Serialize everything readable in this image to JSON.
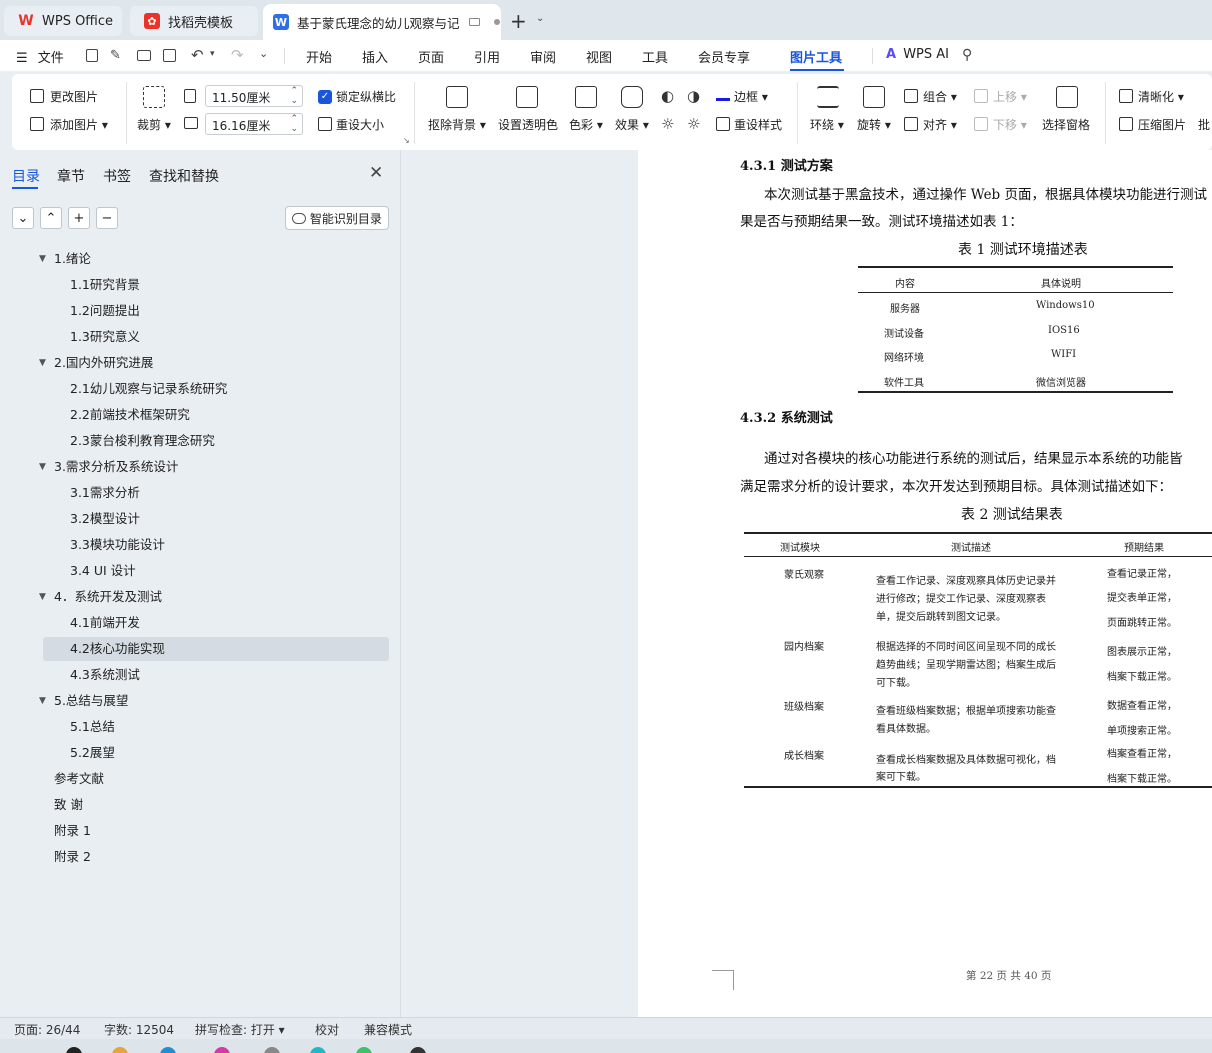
{
  "tabs": [
    {
      "label": "WPS Office",
      "icon": "wps-logo-icon",
      "color": "#e8342a"
    },
    {
      "label": "找稻壳模板",
      "icon": "docer-icon",
      "color": "#e8342a"
    },
    {
      "label": "基于蒙氏理念的幼儿观察与记",
      "icon": "word-doc-icon",
      "color": "#2f6ee6"
    }
  ],
  "menubar": {
    "file": "文件",
    "items": [
      "开始",
      "插入",
      "页面",
      "引用",
      "审阅",
      "视图",
      "工具",
      "会员专享",
      "图片工具"
    ],
    "active": "图片工具",
    "wps_ai": "WPS AI"
  },
  "ribbon": {
    "change_image": "更改图片",
    "add_image": "添加图片",
    "crop": "裁剪",
    "width": "11.50厘米",
    "height": "16.16厘米",
    "lock_ratio": "锁定纵横比",
    "lock_checked": true,
    "reset_size": "重设大小",
    "remove_bg": "抠除背景",
    "set_transparent": "设置透明色",
    "color": "色彩",
    "effect": "效果",
    "border": "边框",
    "reset_style": "重设样式",
    "wrap": "环绕",
    "rotate": "旋转",
    "group": "组合",
    "align": "对齐",
    "move_up": "上移",
    "move_down": "下移",
    "selection_pane": "选择窗格",
    "sharpen": "清晰化",
    "compress": "压缩图片",
    "batch": "批"
  },
  "panel": {
    "tabs": [
      "目录",
      "章节",
      "书签",
      "查找和替换"
    ],
    "smart_toc": "智能识别目录",
    "toc": [
      {
        "label": "1.绪论",
        "level": 1,
        "expanded": true
      },
      {
        "label": "1.1研究背景",
        "level": 2
      },
      {
        "label": "1.2问题提出",
        "level": 2
      },
      {
        "label": "1.3研究意义",
        "level": 2
      },
      {
        "label": "2.国内外研究进展",
        "level": 1,
        "expanded": true
      },
      {
        "label": "2.1幼儿观察与记录系统研究",
        "level": 2
      },
      {
        "label": "2.2前端技术框架研究",
        "level": 2
      },
      {
        "label": "2.3蒙台梭利教育理念研究",
        "level": 2
      },
      {
        "label": "3.需求分析及系统设计",
        "level": 1,
        "expanded": true
      },
      {
        "label": "3.1需求分析",
        "level": 2
      },
      {
        "label": "3.2模型设计",
        "level": 2
      },
      {
        "label": "3.3模块功能设计",
        "level": 2
      },
      {
        "label": "3.4 UI 设计",
        "level": 2
      },
      {
        "label": "4．系统开发及测试",
        "level": 1,
        "expanded": true
      },
      {
        "label": "4.1前端开发",
        "level": 2
      },
      {
        "label": "4.2核心功能实现",
        "level": 2,
        "selected": true
      },
      {
        "label": "4.3系统测试",
        "level": 2
      },
      {
        "label": "5.总结与展望",
        "level": 1,
        "expanded": true
      },
      {
        "label": "5.1总结",
        "level": 2
      },
      {
        "label": "5.2展望",
        "level": 2
      },
      {
        "label": "参考文献",
        "level": 1
      },
      {
        "label": "致 谢",
        "level": 1
      },
      {
        "label": "附录 1",
        "level": 1
      },
      {
        "label": "附录 2",
        "level": 1
      }
    ]
  },
  "doc": {
    "h431": "4.3.1 测试方案",
    "p1a": "本次测试基于黑盒技术，通过操作 Web 页面，根据具体模块功能进行测试",
    "p1b": "果是否与预期结果一致。测试环境描述如表 1：",
    "table1_caption": "表 1  测试环境描述表",
    "table1": {
      "headers": [
        "内容",
        "具体说明"
      ],
      "rows": [
        [
          "服务器",
          "Windows10"
        ],
        [
          "测试设备",
          "IOS16"
        ],
        [
          "网络环境",
          "WIFI"
        ],
        [
          "软件工具",
          "微信浏览器"
        ]
      ]
    },
    "h432": "4.3.2 系统测试",
    "p2a": "通过对各模块的核心功能进行系统的测试后，结果显示本系统的功能皆",
    "p2b": "满足需求分析的设计要求，本次开发达到预期目标。具体测试描述如下：",
    "table2_caption": "表 2 测试结果表",
    "table2": {
      "headers": [
        "测试模块",
        "测试描述",
        "预期结果"
      ],
      "rows": [
        {
          "module": "蒙氏观察",
          "desc": [
            "查看工作记录、深度观察具体历史记录并",
            "进行修改；提交工作记录、深度观察表",
            "单，提交后跳转到图文记录。"
          ],
          "result": [
            "查看记录正常，",
            "提交表单正常，",
            "页面跳转正常。"
          ]
        },
        {
          "module": "园内档案",
          "desc": [
            "根据选择的不同时间区间呈现不同的成长",
            "趋势曲线；呈现学期雷达图；档案生成后",
            "可下载。"
          ],
          "result": [
            "图表展示正常，",
            "档案下载正常。"
          ]
        },
        {
          "module": "班级档案",
          "desc": [
            "查看班级档案数据；根据单项搜索功能查",
            "看具体数据。"
          ],
          "result": [
            "数据查看正常，",
            "单项搜索正常。"
          ]
        },
        {
          "module": "成长档案",
          "desc": [
            "查看成长档案数据及具体数据可视化，档",
            "案可下载。"
          ],
          "result": [
            "档案查看正常，",
            "档案下载正常。"
          ]
        }
      ]
    },
    "page_footer": "第 22 页  共 40 页"
  },
  "status": {
    "page": "页面: 26/44",
    "words": "字数: 12504",
    "spell": "拼写检查: 打开",
    "proof": "校对",
    "compat": "兼容模式"
  }
}
